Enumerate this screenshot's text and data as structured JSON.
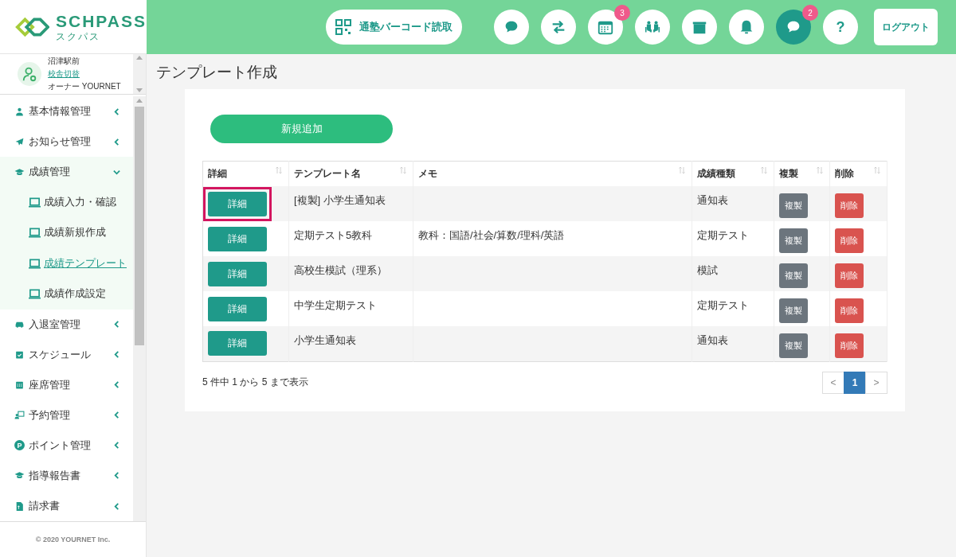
{
  "logo": {
    "name": "SCHPASS",
    "sub": "スクパス"
  },
  "user": {
    "school": "沼津駅前",
    "switch_link": "校舎切替",
    "owner": "オーナー YOURNET"
  },
  "header": {
    "barcode_button": "通塾バーコード読取",
    "icon_buttons": [
      {
        "selected": false
      },
      {
        "selected": false
      },
      {
        "selected": false,
        "badge": "3"
      },
      {
        "selected": false
      },
      {
        "selected": false
      },
      {
        "selected": false
      },
      {
        "selected": true,
        "badge": "2"
      },
      {
        "selected": false,
        "glyph": "?"
      }
    ],
    "logout": "ログアウト"
  },
  "sidebar": {
    "items": [
      {
        "label": "基本情報管理",
        "expanded": false
      },
      {
        "label": "お知らせ管理",
        "expanded": false
      },
      {
        "label": "成績管理",
        "expanded": true,
        "children": [
          {
            "label": "成績入力・確認",
            "selected": false
          },
          {
            "label": "成績新規作成",
            "selected": false
          },
          {
            "label": "成績テンプレート",
            "selected": true
          },
          {
            "label": "成績作成設定",
            "selected": false
          }
        ]
      },
      {
        "label": "入退室管理",
        "expanded": false
      },
      {
        "label": "スケジュール",
        "expanded": false
      },
      {
        "label": "座席管理",
        "expanded": false
      },
      {
        "label": "予約管理",
        "expanded": false
      },
      {
        "label": "ポイント管理",
        "expanded": false,
        "glyph": "P"
      },
      {
        "label": "指導報告書",
        "expanded": false
      },
      {
        "label": "請求書",
        "expanded": false
      }
    ],
    "footer": "© 2020 YOURNET Inc."
  },
  "page_title": "テンプレート作成",
  "add_button": "新規追加",
  "table": {
    "columns": [
      "詳細",
      "テンプレート名",
      "メモ",
      "成績種類",
      "複製",
      "削除"
    ],
    "rows": [
      {
        "detail": "詳細",
        "name": "[複製] 小学生通知表",
        "memo": "",
        "type": "通知表",
        "copy": "複製",
        "delete": "削除",
        "highlighted": true
      },
      {
        "detail": "詳細",
        "name": "定期テスト5教科",
        "memo": "教科：国語/社会/算数/理科/英語",
        "type": "定期テスト",
        "copy": "複製",
        "delete": "削除",
        "highlighted": false
      },
      {
        "detail": "詳細",
        "name": "高校生模試（理系）",
        "memo": "",
        "type": "模試",
        "copy": "複製",
        "delete": "削除",
        "highlighted": false
      },
      {
        "detail": "詳細",
        "name": "中学生定期テスト",
        "memo": "",
        "type": "定期テスト",
        "copy": "複製",
        "delete": "削除",
        "highlighted": false
      },
      {
        "detail": "詳細",
        "name": "小学生通知表",
        "memo": "",
        "type": "通知表",
        "copy": "複製",
        "delete": "削除",
        "highlighted": false
      }
    ]
  },
  "info": "5 件中 1 から 5 まで表示",
  "pagination": [
    {
      "label": "<",
      "selected": false
    },
    {
      "label": "1",
      "selected": true
    },
    {
      "label": ">",
      "selected": false
    }
  ]
}
